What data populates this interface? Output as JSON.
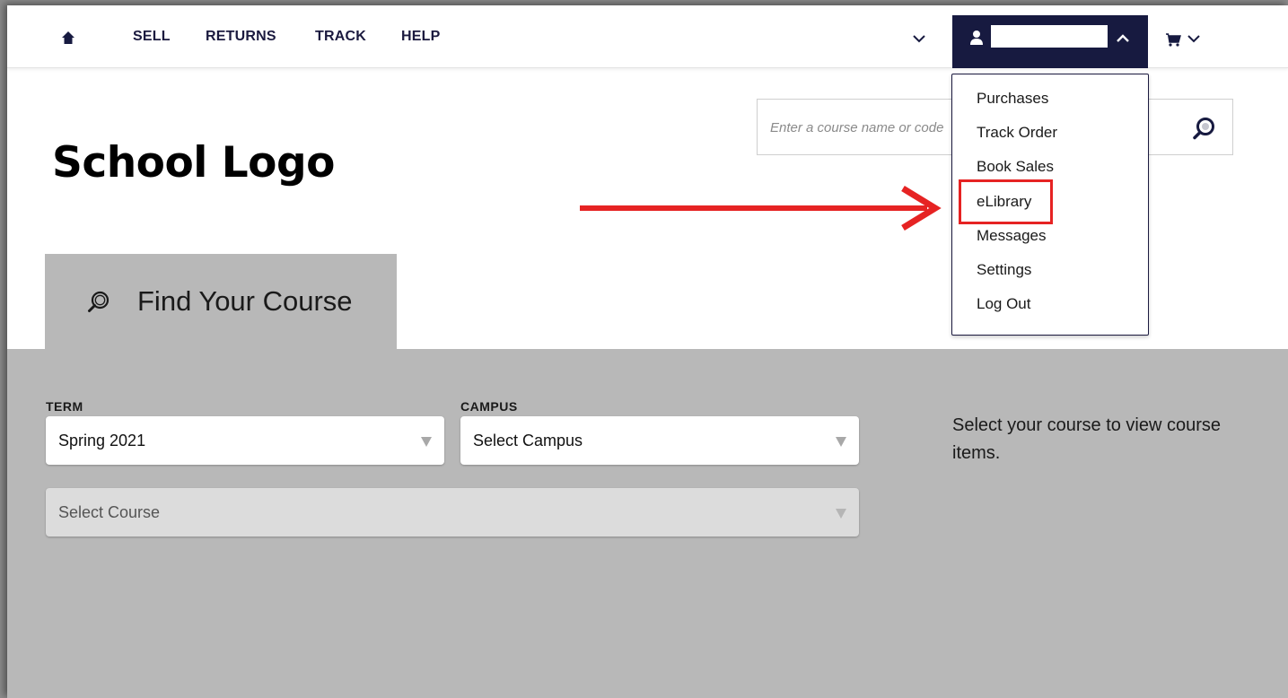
{
  "nav": {
    "links": [
      "SELL",
      "RETURNS",
      "TRACK",
      "HELP"
    ]
  },
  "account": {
    "menu_items": [
      "Purchases",
      "Track Order",
      "Book Sales",
      "eLibrary",
      "Messages",
      "Settings",
      "Log Out"
    ],
    "highlighted_item": "eLibrary"
  },
  "search": {
    "placeholder": "Enter a course name or code"
  },
  "header": {
    "logo_text": "School Logo"
  },
  "finder": {
    "tab_label": "Find Your Course",
    "term_label": "TERM",
    "term_value": "Spring 2021",
    "campus_label": "CAMPUS",
    "campus_value": "Select Campus",
    "course_value": "Select Course",
    "help_text": "Select your course to view course items."
  },
  "colors": {
    "nav_dark": "#171a40",
    "panel_grey": "#b8b8b8",
    "annotation_red": "#e62323"
  },
  "icons": [
    "home-icon",
    "chevron-down-icon",
    "user-icon",
    "chevron-up-icon",
    "cart-icon",
    "search-icon",
    "arrow-right-icon"
  ]
}
